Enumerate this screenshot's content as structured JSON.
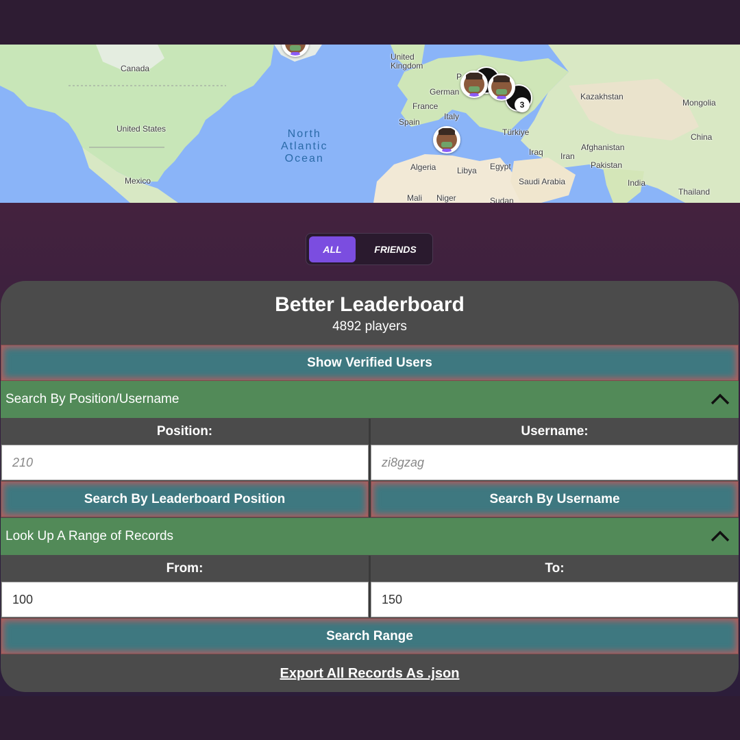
{
  "map": {
    "labels": {
      "canada": "Canada",
      "united_states": "United States",
      "mexico": "Mexico",
      "united_kingdom": "United\nKingdom",
      "germany": "German",
      "france": "France",
      "spain": "Spain",
      "italy": "Italy",
      "turkiye": "Türkiye",
      "iraq": "Iraq",
      "iran": "Iran",
      "afghanistan": "Afghanistan",
      "pakistan": "Pakistan",
      "kazakhstan": "Kazakhstan",
      "mongolia": "Mongolia",
      "china": "China",
      "india": "India",
      "thailand": "Thailand",
      "saudi_arabia": "Saudi Arabia",
      "egypt": "Egypt",
      "libya": "Libya",
      "algeria": "Algeria",
      "mali": "Mali",
      "niger": "Niger",
      "sudan": "Sudan",
      "p_label": "P",
      "ocean": "North\nAtlantic\nOcean"
    },
    "cluster_count": "3"
  },
  "toggle": {
    "all_label": "ALL",
    "friends_label": "FRIENDS",
    "selected": "ALL"
  },
  "panel": {
    "title": "Better Leaderboard",
    "subtitle": "4892 players",
    "show_verified_label": "Show Verified Users",
    "search_section": {
      "header": "Search By Position/Username",
      "position_label": "Position:",
      "username_label": "Username:",
      "position_placeholder": "210",
      "username_placeholder": "zi8gzag",
      "search_position_button": "Search By Leaderboard Position",
      "search_username_button": "Search By Username"
    },
    "range_section": {
      "header": "Look Up A Range of Records",
      "from_label": "From:",
      "to_label": "To:",
      "from_value": "100",
      "to_value": "150",
      "search_range_button": "Search Range"
    },
    "export_label": "Export All Records As .json"
  },
  "colors": {
    "background": "#2e1c33",
    "panel": "#4b4b4b",
    "section_header": "#528a58",
    "teal_button": "#3e7880",
    "toggle_active": "#7b4de0",
    "map_water": "#8ab4f8",
    "map_land": "#c8e6b8"
  }
}
